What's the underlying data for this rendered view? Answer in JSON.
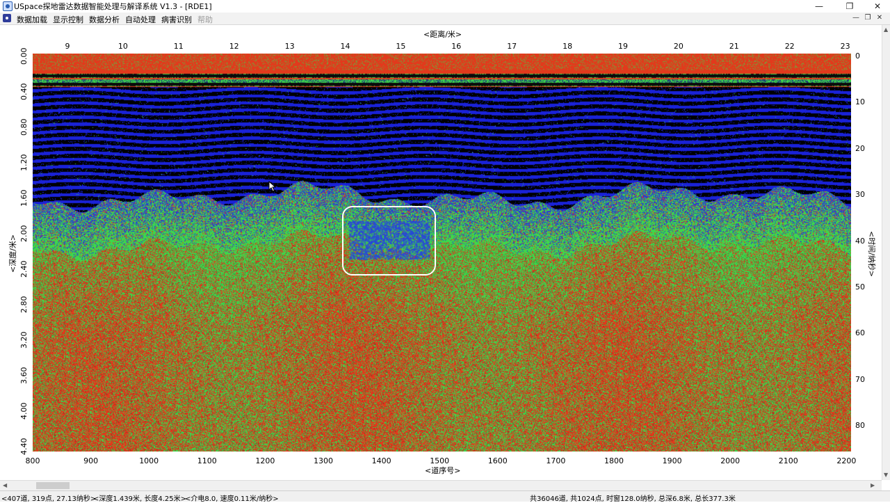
{
  "window": {
    "title": "USpace探地雷达数据智能处理与解译系统 V1.3 - [RDE1]"
  },
  "menu": [
    {
      "label": "数据加载",
      "enabled": true
    },
    {
      "label": "显示控制",
      "enabled": true
    },
    {
      "label": "数据分析",
      "enabled": true
    },
    {
      "label": "自动处理",
      "enabled": true
    },
    {
      "label": "病害识别",
      "enabled": true
    },
    {
      "label": "帮助",
      "enabled": false
    }
  ],
  "radargram": {
    "top_axis_title": "<距离/米>",
    "top_ticks": [
      "9",
      "10",
      "11",
      "12",
      "13",
      "14",
      "15",
      "16",
      "17",
      "18",
      "19",
      "20",
      "21",
      "22",
      "23"
    ],
    "bottom_axis_title": "<道序号>",
    "bottom_ticks": [
      "800",
      "900",
      "1000",
      "1100",
      "1200",
      "1300",
      "1400",
      "1500",
      "1600",
      "1700",
      "1800",
      "1900",
      "2000",
      "2100",
      "2200"
    ],
    "left_axis_title": "<深度/米>",
    "left_ticks": [
      "0.00",
      "0.40",
      "0.80",
      "1.20",
      "1.60",
      "2.00",
      "2.40",
      "2.80",
      "3.20",
      "3.60",
      "4.00",
      "4.40"
    ],
    "right_axis_title": "<时间/纳秒>",
    "right_ticks": [
      "0",
      "10",
      "20",
      "30",
      "40",
      "50",
      "60",
      "70",
      "80"
    ],
    "colors": {
      "red": "#e23a1c",
      "green": "#3fd64a",
      "blue": "#1a22d8",
      "black": "#000000",
      "annotation": "#ffffff"
    }
  },
  "status": {
    "cursor": "<407道, 319点, 27.13纳秒>",
    "depth": "<深度1.439米, 长度4.25米>",
    "medium": "<介电8.0, 速度0.11米/纳秒>",
    "summary": "共36046道, 共1024点, 时窗128.0纳秒, 总深6.8米, 总长377.3米"
  }
}
